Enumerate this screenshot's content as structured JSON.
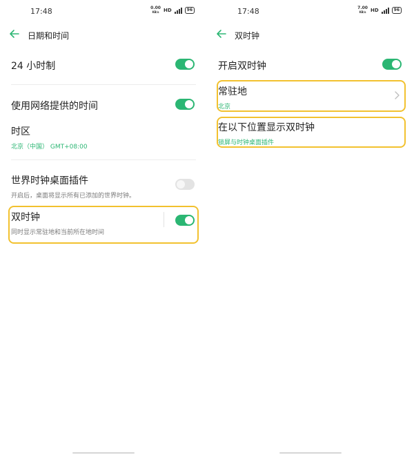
{
  "left": {
    "status": {
      "time": "17:48",
      "speed_top": "0.00",
      "speed_bottom": "KB/s",
      "hd": "HD",
      "battery": "96"
    },
    "header": {
      "title": "日期和时间"
    },
    "items": [
      {
        "label": "24 小时制",
        "toggle": "on"
      },
      {
        "label": "使用网络提供的时间",
        "toggle": "on"
      },
      {
        "label": "时区",
        "sub": "北京（中国） GMT+08:00"
      },
      {
        "label": "世界时钟桌面插件",
        "sub": "开启后，桌面将显示所有已添加的世界时钟。",
        "toggle": "off"
      },
      {
        "label": "双时钟",
        "sub": "同时显示常驻地和当前所在地时间",
        "toggle": "on"
      }
    ]
  },
  "right": {
    "status": {
      "time": "17:48",
      "speed_top": "7.00",
      "speed_bottom": "KB/s",
      "hd": "HD",
      "battery": "96"
    },
    "header": {
      "title": "双时钟"
    },
    "items": [
      {
        "label": "开启双时钟",
        "toggle": "on"
      },
      {
        "label": "常驻地",
        "sub": "北京"
      },
      {
        "label": "在以下位置显示双时钟",
        "sub": "锁屏与时钟桌面插件"
      }
    ]
  },
  "colors": {
    "accent": "#2bb673",
    "highlight": "#f2c12e"
  },
  "icons": [
    "back-arrow-icon",
    "chevron-right-icon",
    "signal-icon",
    "battery-icon"
  ]
}
